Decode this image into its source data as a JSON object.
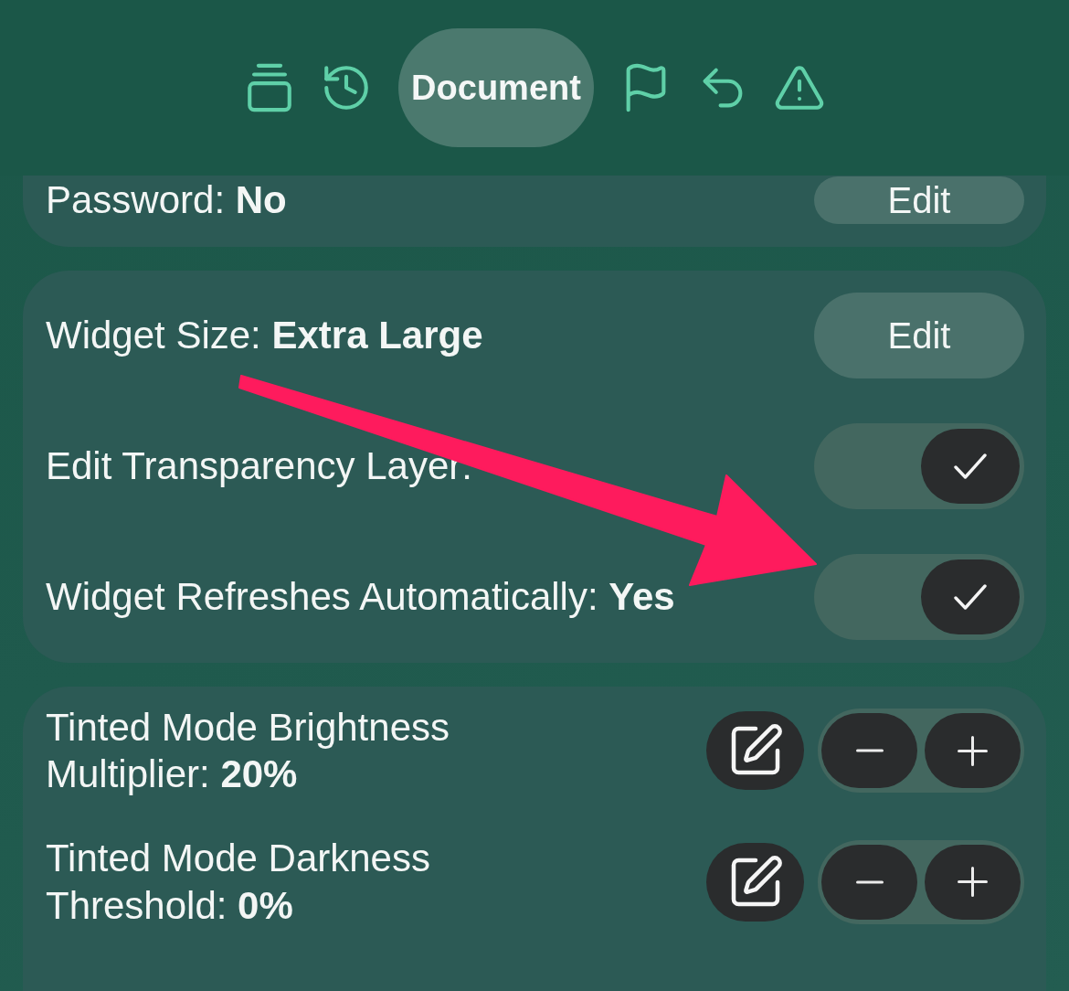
{
  "toolbar": {
    "items": [
      {
        "selected": false
      },
      {
        "selected": false
      },
      {
        "label": "Document",
        "selected": true
      },
      {
        "selected": false
      },
      {
        "selected": false
      },
      {
        "selected": false
      }
    ]
  },
  "cards": [
    {
      "cut": true,
      "rows": [
        {
          "kind": "button",
          "label": "Password: **No**",
          "button": "Edit"
        }
      ]
    },
    {
      "cut": false,
      "rows": [
        {
          "kind": "button",
          "label": "Widget Size: **Extra Large**",
          "button": "Edit"
        },
        {
          "kind": "toggle",
          "label": "Edit Transparency Layer:",
          "checked": true
        },
        {
          "kind": "toggle",
          "label": "Widget Refreshes Automatically: **Yes**",
          "checked": true
        }
      ]
    },
    {
      "cut": false,
      "rows": [
        {
          "kind": "stepper",
          "label": "Tinted Mode Brightness Multiplier: **20%**"
        },
        {
          "kind": "stepper",
          "label": "Tinted Mode Darkness Threshold: **0%**"
        }
      ]
    }
  ],
  "annotations": [
    {
      "kind": "arrow"
    }
  ]
}
